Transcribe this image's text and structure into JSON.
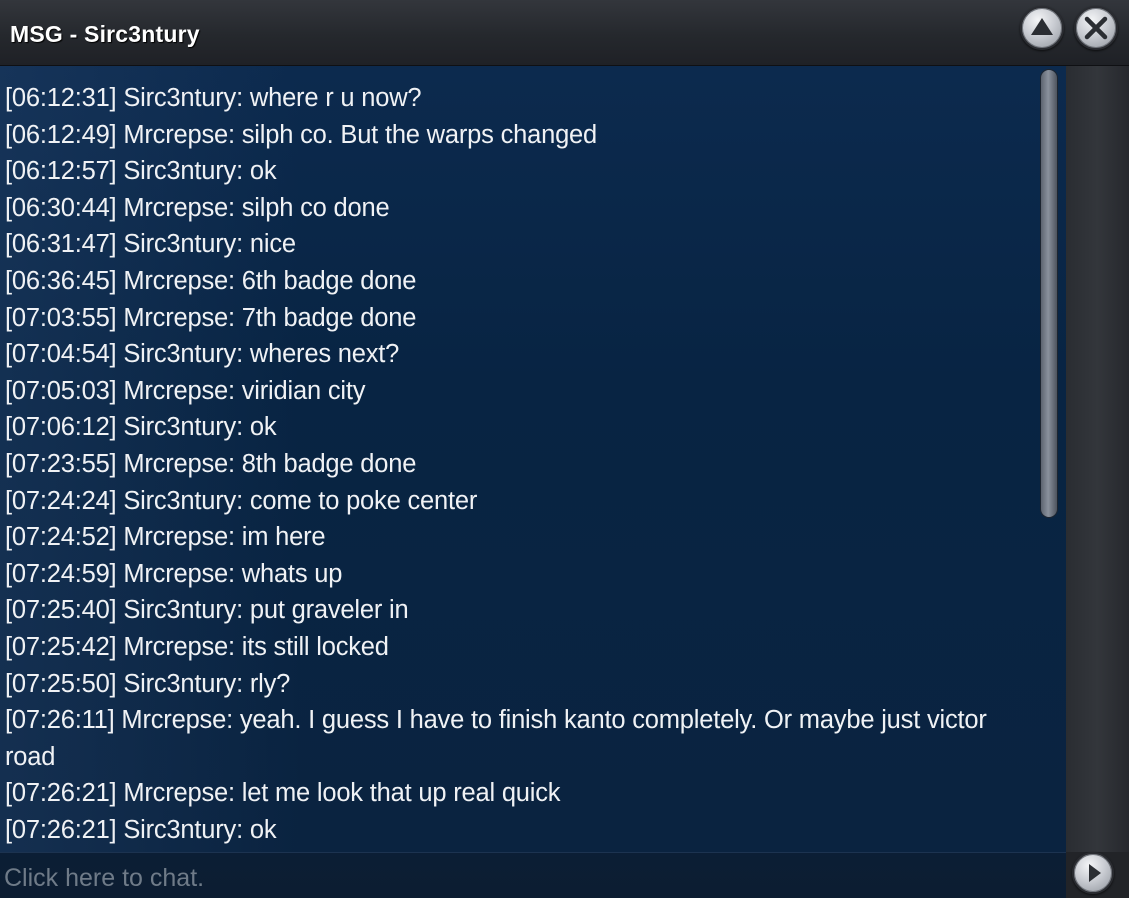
{
  "window": {
    "title": "MSG - Sirc3ntury"
  },
  "titlebar_buttons": {
    "minimize_icon": "chevron-up-icon",
    "close_icon": "close-icon"
  },
  "messages": [
    "[06:12:31] Sirc3ntury: where r u now?",
    "[06:12:49] Mrcrepse: silph co. But the warps changed",
    "[06:12:57] Sirc3ntury: ok",
    "[06:30:44] Mrcrepse: silph co done",
    "[06:31:47] Sirc3ntury: nice",
    "[06:36:45] Mrcrepse: 6th badge done",
    "[07:03:55] Mrcrepse: 7th badge done",
    "[07:04:54] Sirc3ntury: wheres next?",
    "[07:05:03] Mrcrepse: viridian city",
    "[07:06:12] Sirc3ntury: ok",
    "[07:23:55] Mrcrepse: 8th badge done",
    "[07:24:24] Sirc3ntury: come to poke center",
    "[07:24:52] Mrcrepse: im here",
    "[07:24:59] Mrcrepse: whats up",
    "[07:25:40] Sirc3ntury: put graveler in",
    "[07:25:42] Mrcrepse: its still locked",
    "[07:25:50] Sirc3ntury: rly?",
    "[07:26:11] Mrcrepse: yeah. I guess I have to finish kanto completely. Or maybe just victor road",
    "[07:26:21] Mrcrepse: let me look that up real quick",
    "[07:26:21] Sirc3ntury: ok"
  ],
  "input": {
    "placeholder": "Click here to chat."
  },
  "send_button": {
    "icon": "play-arrow-icon"
  },
  "colors": {
    "chat_background": "#082443",
    "text": "#f0f2f5",
    "placeholder": "#6f7b88",
    "titlebar": "#25282d"
  }
}
